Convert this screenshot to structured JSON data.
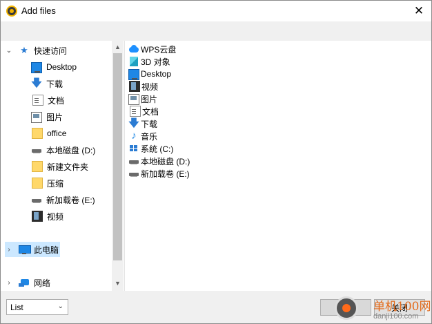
{
  "window": {
    "title": "Add files",
    "close_glyph": "✕"
  },
  "tree": {
    "items": [
      {
        "label": "快速访问",
        "icon": "star-icon",
        "expanded": true
      },
      {
        "label": "Desktop",
        "icon": "desktop-icon"
      },
      {
        "label": "下载",
        "icon": "download-icon"
      },
      {
        "label": "文档",
        "icon": "document-icon"
      },
      {
        "label": "图片",
        "icon": "picture-icon"
      },
      {
        "label": "office",
        "icon": "folder-icon"
      },
      {
        "label": "本地磁盘 (D:)",
        "icon": "drive-icon"
      },
      {
        "label": "新建文件夹",
        "icon": "folder-icon"
      },
      {
        "label": "压缩",
        "icon": "folder-icon"
      },
      {
        "label": "新加载卷 (E:)",
        "icon": "drive-icon"
      },
      {
        "label": "视频",
        "icon": "video-icon"
      },
      {
        "label": "此电脑",
        "icon": "computer-icon",
        "selected": true
      },
      {
        "label": "网络",
        "icon": "network-icon"
      }
    ]
  },
  "files": {
    "items": [
      {
        "label": "WPS云盘",
        "icon": "cloud-icon"
      },
      {
        "label": "3D 对象",
        "icon": "cube-icon"
      },
      {
        "label": "Desktop",
        "icon": "desktop-icon"
      },
      {
        "label": "视频",
        "icon": "video-icon"
      },
      {
        "label": "图片",
        "icon": "picture-icon"
      },
      {
        "label": "文档",
        "icon": "document-icon"
      },
      {
        "label": "下载",
        "icon": "download-icon"
      },
      {
        "label": "音乐",
        "icon": "music-icon"
      },
      {
        "label": "系统 (C:)",
        "icon": "windows-drive-icon"
      },
      {
        "label": "本地磁盘 (D:)",
        "icon": "drive-icon"
      },
      {
        "label": "新加载卷 (E:)",
        "icon": "drive-icon"
      }
    ]
  },
  "bottom": {
    "view_mode": "List",
    "add_label": "+",
    "close_label": "关闭"
  },
  "watermark": {
    "line1": "单机100网",
    "line2": "danji100.com"
  },
  "colors": {
    "selection": "#cce8ff",
    "toolbar": "#f0f0f0",
    "accent": "#2b7cd3"
  }
}
